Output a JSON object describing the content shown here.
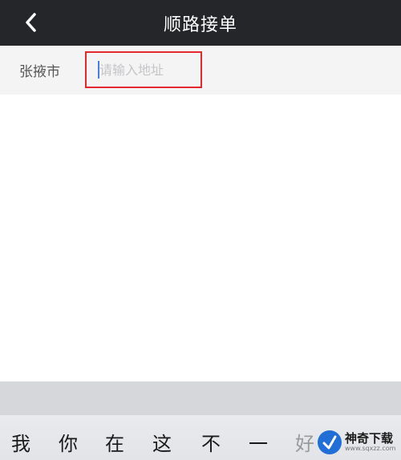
{
  "header": {
    "back_icon": "chevron-left-icon",
    "title": "顺路接单"
  },
  "search": {
    "city": "张掖市",
    "placeholder": "请输入地址",
    "value": ""
  },
  "keyboard": {
    "candidates": [
      "我",
      "你",
      "在",
      "这",
      "不",
      "一",
      "好"
    ]
  },
  "watermark": {
    "name": "神奇下载",
    "url": "www.sqxzz.com"
  },
  "colors": {
    "header_bg": "#25262a",
    "highlight_border": "#e4282e",
    "cursor": "#4a7df0"
  }
}
